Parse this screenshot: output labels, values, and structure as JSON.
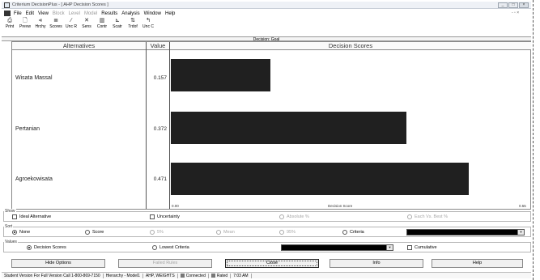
{
  "window": {
    "title": "Criterium DecisionPlus - [ AHP Decision Scores ]",
    "controls": [
      "_",
      "□",
      "×"
    ],
    "mdi_controls": "- ▫ ×"
  },
  "menu": [
    "File",
    "Edit",
    "View",
    "Block",
    "Level",
    "Model",
    "Results",
    "Analysis",
    "Window",
    "Help"
  ],
  "menu_disabled": [
    false,
    false,
    false,
    true,
    true,
    true,
    false,
    false,
    false,
    false
  ],
  "toolbar": [
    {
      "label": "Print",
      "icon": "printer-icon",
      "glyph": "⎙"
    },
    {
      "label": "Prevw",
      "icon": "preview-icon",
      "glyph": "🗋"
    },
    {
      "label": "Hrchy",
      "icon": "hierarchy-icon",
      "glyph": "⪡"
    },
    {
      "label": "Scores",
      "icon": "scores-icon",
      "glyph": "≣"
    },
    {
      "label": "Unc R",
      "icon": "uncertainty-icon",
      "glyph": "∕"
    },
    {
      "label": "Sens",
      "icon": "sensitivity-icon",
      "glyph": "✕"
    },
    {
      "label": "Contr",
      "icon": "contribution-icon",
      "glyph": "▥"
    },
    {
      "label": "Scatr",
      "icon": "scatter-icon",
      "glyph": "⊾"
    },
    {
      "label": "Trdof",
      "icon": "tradeoff-icon",
      "glyph": "⇅"
    },
    {
      "label": "Unc C",
      "icon": "uncertainty-c-icon",
      "glyph": "↰"
    }
  ],
  "goal_label": "Decision: Goal",
  "table": {
    "col_alternatives": "Alternatives",
    "col_value": "Value",
    "col_scores": "Decision Scores",
    "axis_min": "0.00",
    "axis_label": "Decision Score",
    "axis_max": "0.55"
  },
  "chart_data": {
    "type": "bar",
    "categories": [
      "Wisata Massal",
      "Pertanian",
      "Agroekowisata"
    ],
    "values": [
      0.157,
      0.372,
      0.471
    ],
    "value_labels": [
      "0.157",
      "0.372",
      "0.471"
    ],
    "xlabel": "Decision Score",
    "xlim": [
      0,
      0.55
    ],
    "orientation": "horizontal"
  },
  "show": {
    "title": "Show",
    "options": [
      {
        "label": "Ideal Alternative",
        "checked": false,
        "enabled": true
      },
      {
        "label": "Uncertainty",
        "checked": false,
        "enabled": true
      },
      {
        "label": "Absolute %",
        "checked": false,
        "enabled": false
      },
      {
        "label": "Each Vs. Best %",
        "checked": false,
        "enabled": false
      }
    ]
  },
  "sort": {
    "title": "Sort",
    "options": [
      {
        "label": "None",
        "selected": true,
        "enabled": true
      },
      {
        "label": "Score",
        "selected": false,
        "enabled": true
      },
      {
        "label": "5%",
        "selected": false,
        "enabled": false
      },
      {
        "label": "Mean",
        "selected": false,
        "enabled": false
      },
      {
        "label": "95%",
        "selected": false,
        "enabled": false
      },
      {
        "label": "Criteria",
        "selected": false,
        "enabled": true
      }
    ]
  },
  "values": {
    "title": "Values",
    "options": [
      {
        "label": "Decision Scores",
        "selected": true
      },
      {
        "label": "Lowest Criteria",
        "selected": false
      }
    ],
    "cumulative_label": "Cumulative"
  },
  "buttons": [
    {
      "label": "Hide Options",
      "enabled": true
    },
    {
      "label": "Failed Rules",
      "enabled": false
    },
    {
      "label": "Close",
      "enabled": true
    },
    {
      "label": "Info",
      "enabled": true
    },
    {
      "label": "Help",
      "enabled": true
    }
  ],
  "status": {
    "version": "Student Version For Full Version Call 1-800-869-7150",
    "model": "Hierarchy - Model1",
    "method": "AHP, WEIGHTS",
    "connected": "Connected",
    "rated": "Rated",
    "time": "7:03 AM"
  }
}
